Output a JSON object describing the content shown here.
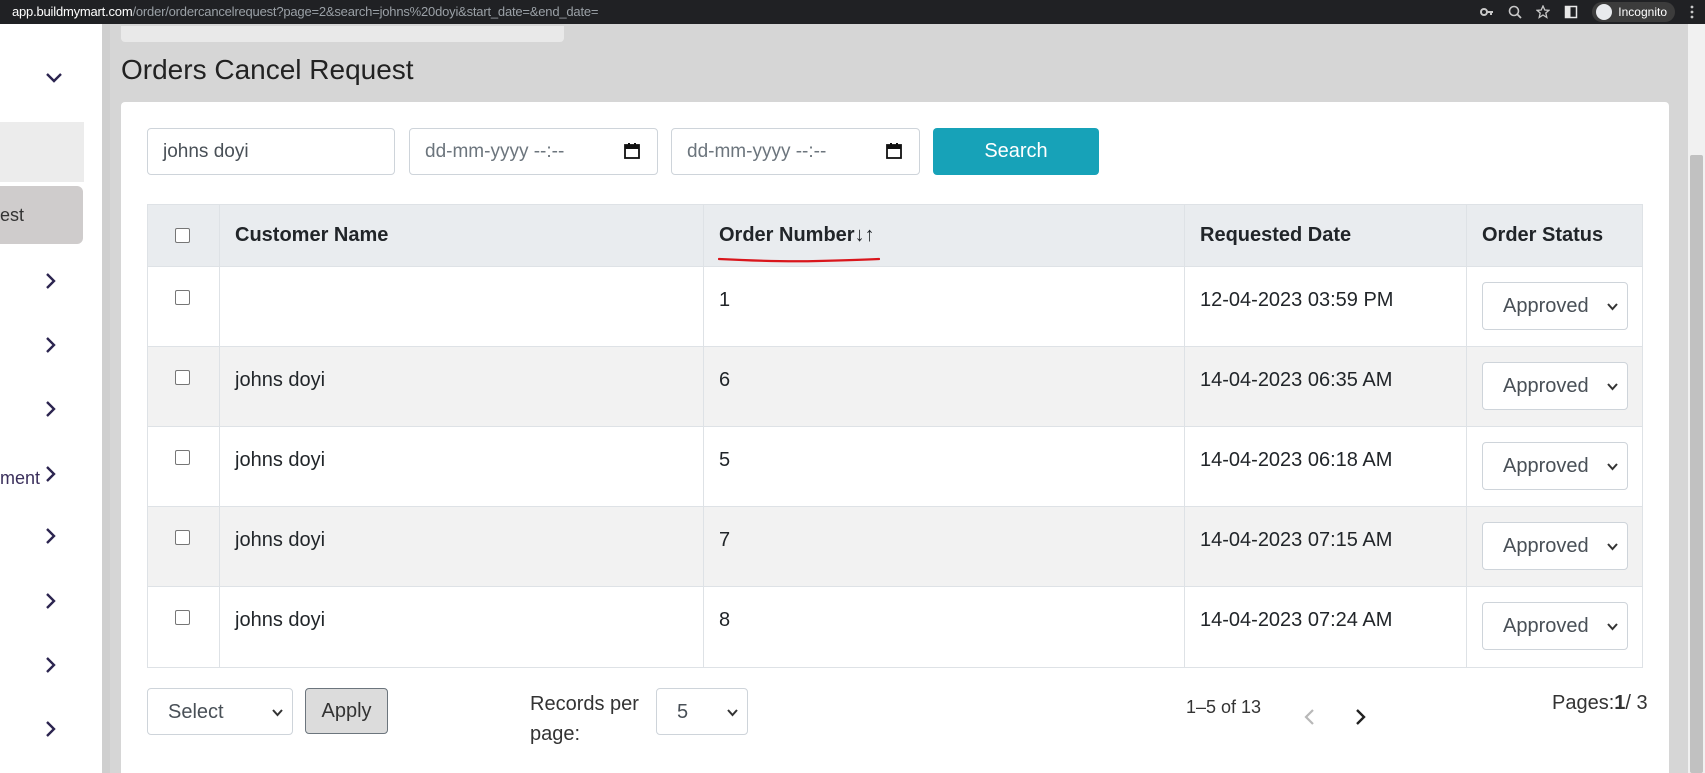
{
  "browser": {
    "url_domain": "app.buildmymart.com",
    "url_path": "/order/ordercancelrequest?page=2&search=johns%20doyi&start_date=&end_date=",
    "incognito_label": "Incognito"
  },
  "sidebar": {
    "active_label": "est",
    "items": [
      {
        "label": ""
      },
      {
        "label": ""
      },
      {
        "label": ""
      },
      {
        "label": "ment"
      },
      {
        "label": ""
      },
      {
        "label": ""
      },
      {
        "label": ""
      },
      {
        "label": ""
      }
    ]
  },
  "page": {
    "title": "Orders Cancel Request"
  },
  "filters": {
    "search_value": "johns doyi",
    "start_date_placeholder": "dd-mm-yyyy --:--",
    "end_date_placeholder": "dd-mm-yyyy --:--",
    "search_button": "Search"
  },
  "table": {
    "headers": {
      "customer_name": "Customer Name",
      "order_number": "Order Number↓↑",
      "requested_date": "Requested Date",
      "order_status": "Order Status"
    },
    "rows": [
      {
        "customer": "",
        "order_number": "1",
        "requested_date": "12-04-2023 03:59 PM",
        "status": "Approved"
      },
      {
        "customer": "johns doyi",
        "order_number": "6",
        "requested_date": "14-04-2023 06:35 AM",
        "status": "Approved"
      },
      {
        "customer": "johns doyi",
        "order_number": "5",
        "requested_date": "14-04-2023 06:18 AM",
        "status": "Approved"
      },
      {
        "customer": "johns doyi",
        "order_number": "7",
        "requested_date": "14-04-2023 07:15 AM",
        "status": "Approved"
      },
      {
        "customer": "johns doyi",
        "order_number": "8",
        "requested_date": "14-04-2023 07:24 AM",
        "status": "Approved"
      }
    ]
  },
  "footer": {
    "bulk_select": "Select",
    "apply_button": "Apply",
    "records_per_page_label": "Records per page:",
    "records_per_page_value": "5",
    "range_text": "1–5 of 13",
    "pages_label": "Pages:",
    "current_page": "1",
    "total_pages": "/ 3"
  },
  "colors": {
    "accent": "#17a2b8",
    "header_bg": "#e9ecef",
    "sort_underline": "#d9161c"
  }
}
